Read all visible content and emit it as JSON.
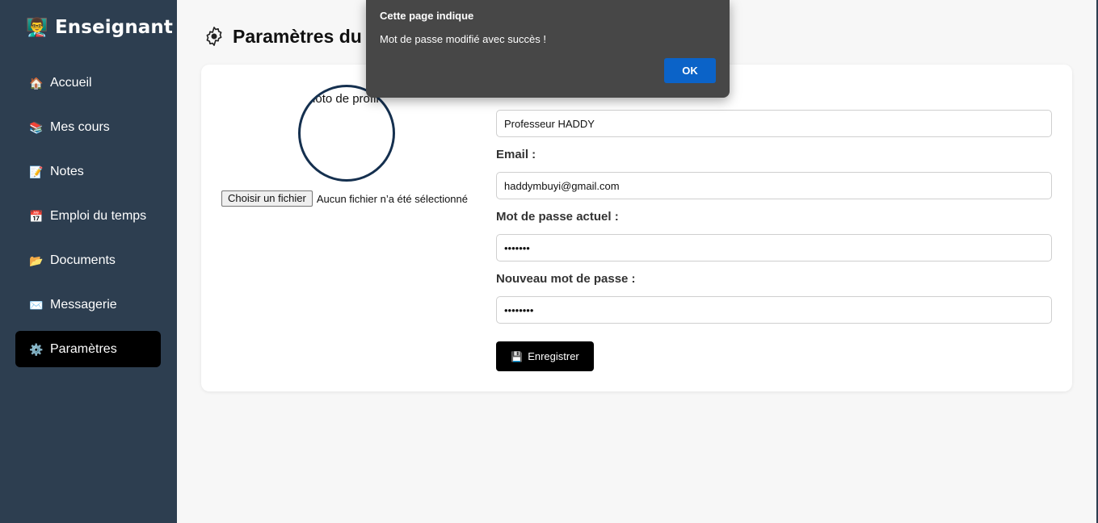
{
  "sidebar": {
    "brand": {
      "icon": "teacher-emoji",
      "title": "Enseignant"
    },
    "items": [
      {
        "icon": "house-icon",
        "glyph": "🏠",
        "label": "Accueil",
        "active": false
      },
      {
        "icon": "books-icon",
        "glyph": "📚",
        "label": "Mes cours",
        "active": false
      },
      {
        "icon": "memo-icon",
        "glyph": "📝",
        "label": "Notes",
        "active": false
      },
      {
        "icon": "calendar-icon",
        "glyph": "📅",
        "label": "Emploi du temps",
        "active": false
      },
      {
        "icon": "folder-icon",
        "glyph": "📂",
        "label": "Documents",
        "active": false
      },
      {
        "icon": "envelope-icon",
        "glyph": "✉️",
        "label": "Messagerie",
        "active": false
      },
      {
        "icon": "gear-icon",
        "glyph": "⚙️",
        "label": "Paramètres",
        "active": true
      }
    ]
  },
  "main": {
    "title": "Paramètres du",
    "profile": {
      "avatar_alt": "Photo de profil",
      "file_button": "Choisir un fichier",
      "file_status": "Aucun fichier n’a été sélectionné"
    },
    "form": {
      "name_value": "Professeur HADDY",
      "email_label": "Email :",
      "email_value": "haddymbuyi@gmail.com",
      "current_password_label": "Mot de passe actuel :",
      "current_password_value": "•••••••",
      "new_password_label": "Nouveau mot de passe :",
      "new_password_value": "••••••••",
      "save_label": "Enregistrer",
      "save_icon": "floppy-disk-icon"
    }
  },
  "dialog": {
    "title": "Cette page indique",
    "message": "Mot de passe modifié avec succès !",
    "ok_label": "OK"
  },
  "colors": {
    "sidebar_bg": "#2d3e50",
    "active_item_bg": "#000000",
    "dialog_bg": "#474747",
    "dialog_button": "#0b63c8",
    "avatar_border": "#15304f"
  }
}
